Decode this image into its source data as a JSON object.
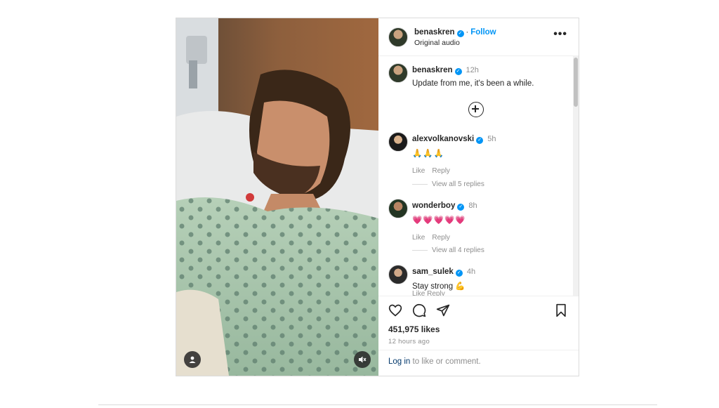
{
  "header": {
    "username": "benaskren",
    "follow_label": "Follow",
    "subtitle": "Original audio",
    "more_label": "•••"
  },
  "caption": {
    "username": "benaskren",
    "time": "12h",
    "text": "Update from me, it's been a while."
  },
  "comments": [
    {
      "username": "alexvolkanovski",
      "time": "5h",
      "text": "🙏🙏🙏",
      "like_label": "Like",
      "reply_label": "Reply",
      "view_replies": "View all 5 replies"
    },
    {
      "username": "wonderboy",
      "time": "8h",
      "text": "💗💗💗💗💗",
      "like_label": "Like",
      "reply_label": "Reply",
      "view_replies": "View all 4 replies"
    },
    {
      "username": "sam_sulek",
      "time": "4h",
      "text": "Stay strong 💪",
      "like_label": "Like",
      "reply_label": "Reply"
    }
  ],
  "stats": {
    "likes": "451,975 likes",
    "time_ago": "12 hours ago"
  },
  "login": {
    "link": "Log in",
    "text": " to like or comment."
  },
  "icons": {
    "like": "heart-icon",
    "comment": "comment-icon",
    "share": "share-icon",
    "save": "bookmark-icon",
    "user_tag": "user-icon",
    "mute": "muted-speaker-icon",
    "load_more": "plus-circle-icon"
  },
  "colors": {
    "accent": "#0095f6",
    "text": "#262626",
    "muted": "#8e8e8e",
    "link": "#00376b",
    "border": "#dbdbdb"
  }
}
